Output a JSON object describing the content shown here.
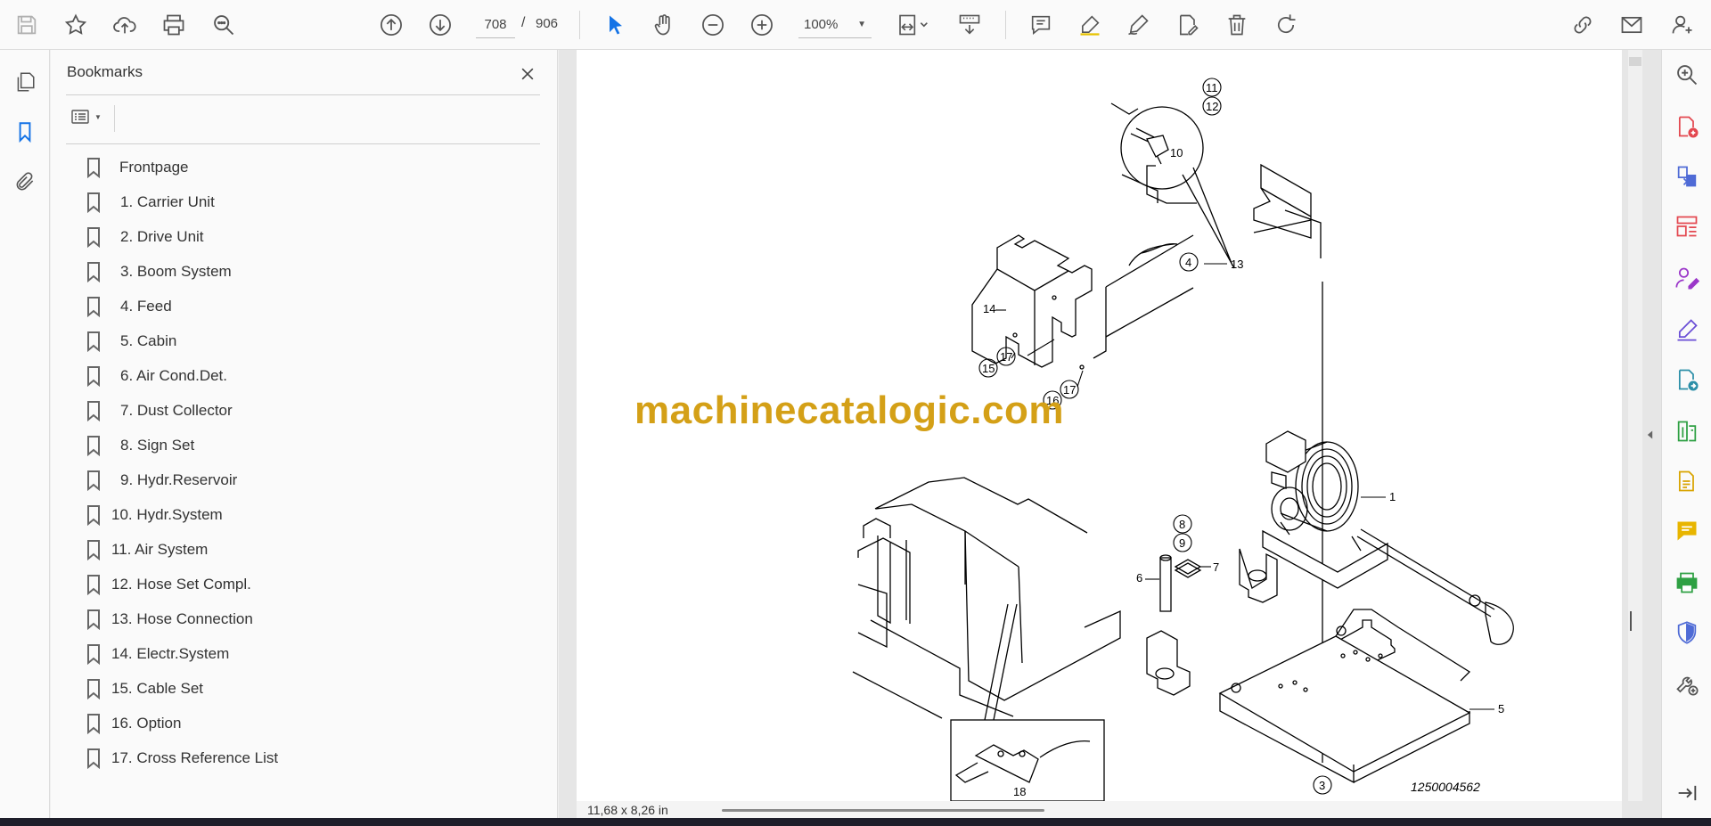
{
  "toolbar": {
    "page_current": "708",
    "page_separator": "/",
    "page_total": "906",
    "zoom": "100%"
  },
  "bookmarks": {
    "title": "Bookmarks",
    "items": [
      {
        "label": "Frontpage"
      },
      {
        "label": "1. Carrier Unit"
      },
      {
        "label": "2. Drive Unit"
      },
      {
        "label": "3. Boom System"
      },
      {
        "label": "4. Feed"
      },
      {
        "label": "5. Cabin"
      },
      {
        "label": "6. Air Cond.Det."
      },
      {
        "label": "7. Dust Collector"
      },
      {
        "label": "8. Sign Set"
      },
      {
        "label": "9. Hydr.Reservoir"
      },
      {
        "label": "10. Hydr.System"
      },
      {
        "label": "11. Air System"
      },
      {
        "label": "12. Hose Set Compl."
      },
      {
        "label": "13. Hose Connection"
      },
      {
        "label": "14. Electr.System"
      },
      {
        "label": "15. Cable Set"
      },
      {
        "label": "16. Option"
      },
      {
        "label": "17. Cross Reference List"
      }
    ]
  },
  "document": {
    "watermark": "machinecatalogic.com",
    "page_size": "11,68 x 8,26 in",
    "drawing_number": "1250004562",
    "callouts": [
      "11",
      "12",
      "10",
      "4",
      "13",
      "14",
      "17",
      "15",
      "17",
      "16",
      "1",
      "8",
      "9",
      "7",
      "6",
      "5",
      "18",
      "3"
    ]
  },
  "colors": {
    "accent": "#1473e6",
    "watermark": "#d4a017"
  }
}
